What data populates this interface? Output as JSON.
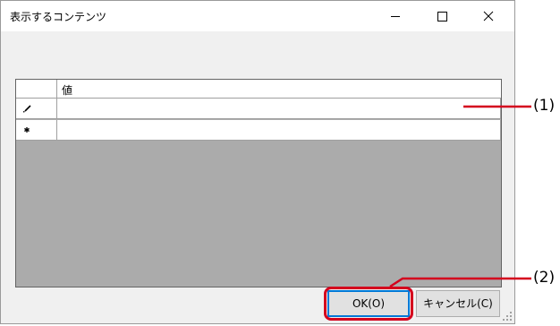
{
  "window": {
    "title": "表示するコンテンツ"
  },
  "grid": {
    "column_header": "値",
    "rows": [
      {
        "marker_icon": "pencil-icon",
        "value": ""
      },
      {
        "marker_icon": "asterisk-icon",
        "value": ""
      }
    ]
  },
  "buttons": {
    "ok_label": "OK(O)",
    "cancel_label": "キャンセル(C)"
  },
  "callouts": {
    "label_1": "(1)",
    "label_2": "(2)"
  },
  "colors": {
    "annotation_red": "#d4001d",
    "focus_blue": "#0078d7"
  }
}
